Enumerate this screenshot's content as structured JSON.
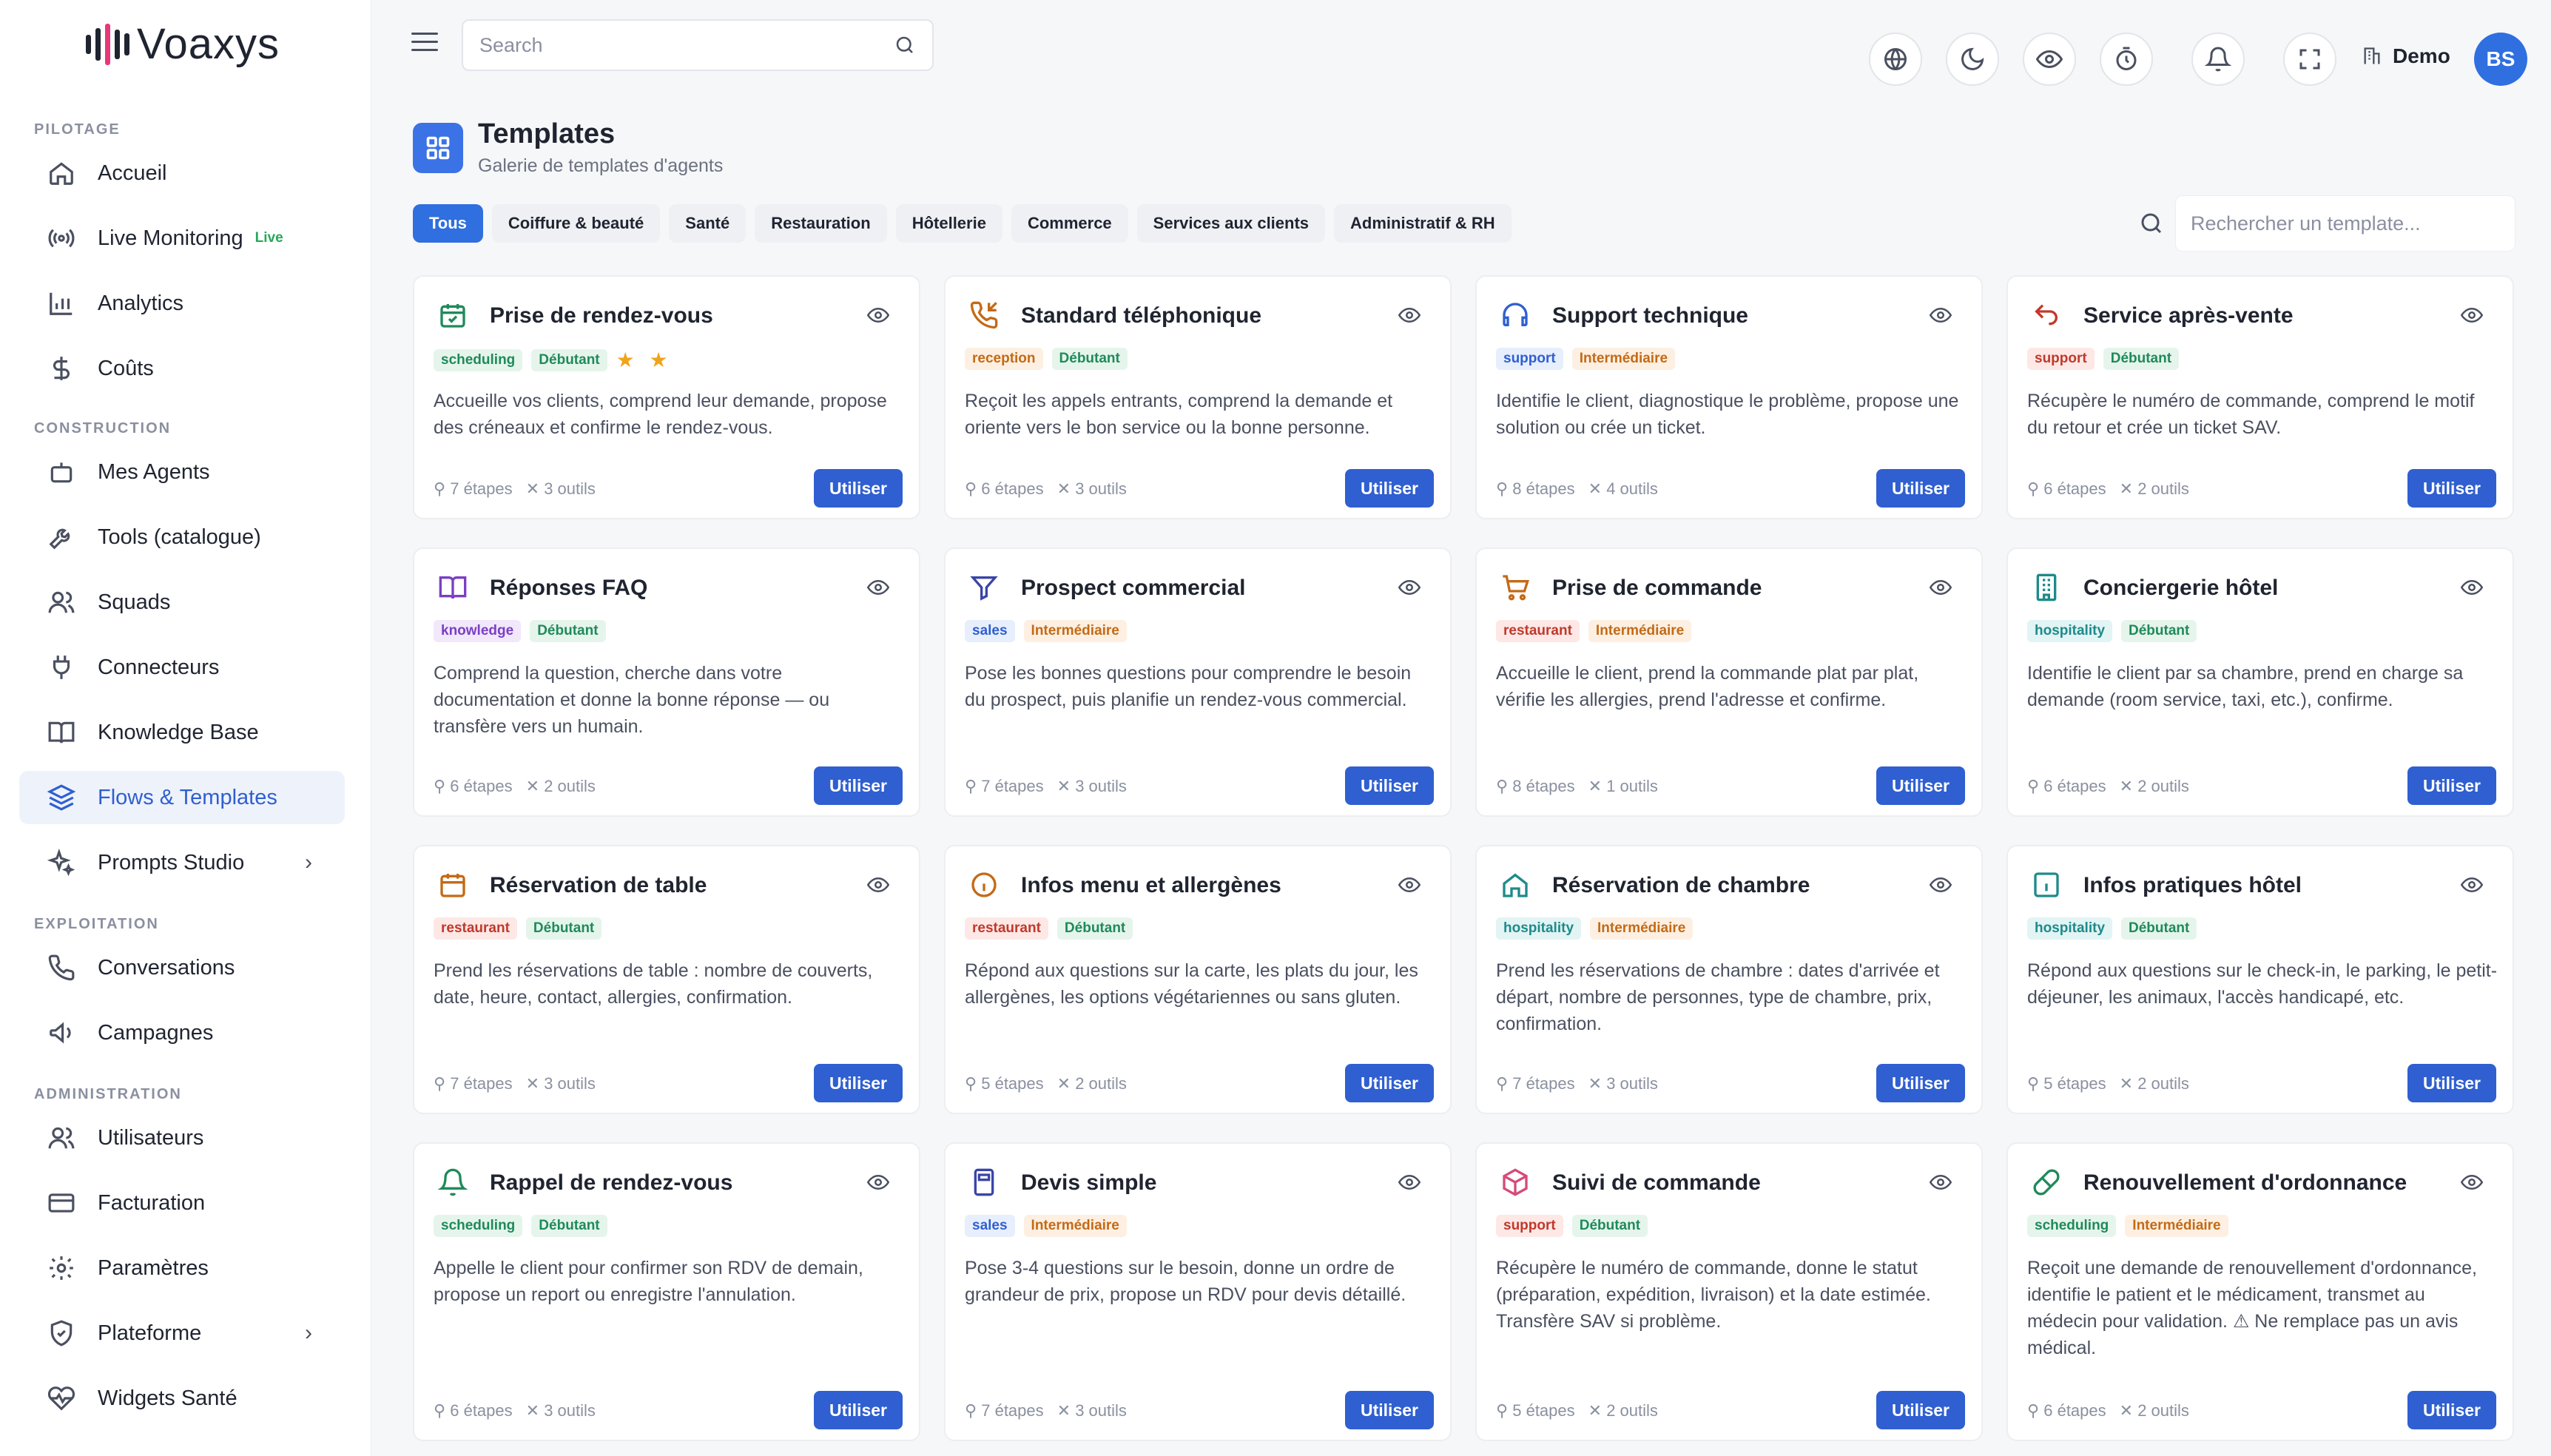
{
  "brand": {
    "name": "Voaxys"
  },
  "sidebar": {
    "sections": [
      "PILOTAGE",
      "CONSTRUCTION",
      "EXPLOITATION",
      "ADMINISTRATION"
    ],
    "items": [
      {
        "label": "Accueil",
        "icon": "home-icon"
      },
      {
        "label": "Live Monitoring",
        "icon": "broadcast-icon",
        "badge": "Live"
      },
      {
        "label": "Analytics",
        "icon": "bar-chart-icon"
      },
      {
        "label": "Coûts",
        "icon": "dollar-icon"
      },
      {
        "label": "Mes Agents",
        "icon": "bot-icon"
      },
      {
        "label": "Tools (catalogue)",
        "icon": "wrench-icon"
      },
      {
        "label": "Squads",
        "icon": "users-icon"
      },
      {
        "label": "Connecteurs",
        "icon": "plug-icon"
      },
      {
        "label": "Knowledge Base",
        "icon": "book-icon"
      },
      {
        "label": "Flows & Templates",
        "icon": "layers-icon",
        "active": true
      },
      {
        "label": "Prompts Studio",
        "icon": "sparkles-icon"
      },
      {
        "label": "Conversations",
        "icon": "phone-icon"
      },
      {
        "label": "Campagnes",
        "icon": "megaphone-icon"
      },
      {
        "label": "Utilisateurs",
        "icon": "users-icon"
      },
      {
        "label": "Facturation",
        "icon": "credit-card-icon"
      },
      {
        "label": "Paramètres",
        "icon": "gear-icon"
      },
      {
        "label": "Plateforme",
        "icon": "shield-icon"
      },
      {
        "label": "Widgets Santé",
        "icon": "heart-pulse-icon"
      }
    ]
  },
  "topbar": {
    "search_placeholder": "Search",
    "workspace": "Demo",
    "avatar_initials": "BS"
  },
  "page": {
    "title": "Templates",
    "subtitle": "Galerie de templates d'agents"
  },
  "filters": {
    "tabs": [
      "Tous",
      "Coiffure & beauté",
      "Santé",
      "Restauration",
      "Hôtellerie",
      "Commerce",
      "Services aux clients",
      "Administratif & RH"
    ],
    "active": "Tous",
    "search_placeholder": "Rechercher un template..."
  },
  "action_label": "Utiliser",
  "colors": {
    "primary": "#2f5fd0",
    "scheduling": "#1f8a5a",
    "reception": "#c46a16",
    "support": "#c0392b",
    "support_tech": "#2f5fd0",
    "knowledge": "#7b3fc4",
    "sales": "#2f5fd0",
    "restaurant": "#c0392b",
    "hospitality": "#1f8a8a",
    "debutant": "#1f8a5a",
    "intermediaire": "#c46a16"
  },
  "templates": [
    {
      "title": "Prise de rendez-vous",
      "icon": "calendar-check-icon",
      "tag": "scheduling",
      "level": "Débutant",
      "stars": "★ ★",
      "desc": "Accueille vos clients, comprend leur demande, propose des créneaux et confirme le rendez-vous.",
      "steps": "7 étapes",
      "tools": "3 outils"
    },
    {
      "title": "Standard téléphonique",
      "icon": "phone-incoming-icon",
      "tag": "reception",
      "level": "Débutant",
      "stars": "",
      "desc": "Reçoit les appels entrants, comprend la demande et oriente vers le bon service ou la bonne personne.",
      "steps": "6 étapes",
      "tools": "3 outils"
    },
    {
      "title": "Support technique",
      "icon": "headset-icon",
      "tag": "support",
      "level": "Intermédiaire",
      "stars": "",
      "desc": "Identifie le client, diagnostique le problème, propose une solution ou crée un ticket.",
      "steps": "8 étapes",
      "tools": "4 outils"
    },
    {
      "title": "Service après-vente",
      "icon": "return-arrow-icon",
      "tag": "support",
      "level": "Débutant",
      "stars": "",
      "desc": "Récupère le numéro de commande, comprend le motif du retour et crée un ticket SAV.",
      "steps": "6 étapes",
      "tools": "2 outils"
    },
    {
      "title": "Réponses FAQ",
      "icon": "book-open-icon",
      "tag": "knowledge",
      "level": "Débutant",
      "stars": "",
      "desc": "Comprend la question, cherche dans votre documentation et donne la bonne réponse — ou transfère vers un humain.",
      "steps": "6 étapes",
      "tools": "2 outils"
    },
    {
      "title": "Prospect commercial",
      "icon": "funnel-icon",
      "tag": "sales",
      "level": "Intermédiaire",
      "stars": "",
      "desc": "Pose les bonnes questions pour comprendre le besoin du prospect, puis planifie un rendez-vous commercial.",
      "steps": "7 étapes",
      "tools": "3 outils"
    },
    {
      "title": "Prise de commande",
      "icon": "cart-icon",
      "tag": "restaurant",
      "level": "Intermédiaire",
      "stars": "",
      "desc": "Accueille le client, prend la commande plat par plat, vérifie les allergies, prend l'adresse et confirme.",
      "steps": "8 étapes",
      "tools": "1 outils"
    },
    {
      "title": "Conciergerie hôtel",
      "icon": "building-icon",
      "tag": "hospitality",
      "level": "Débutant",
      "stars": "",
      "desc": "Identifie le client par sa chambre, prend en charge sa demande (room service, taxi, etc.), confirme.",
      "steps": "6 étapes",
      "tools": "2 outils"
    },
    {
      "title": "Réservation de table",
      "icon": "calendar-icon",
      "tag": "restaurant",
      "level": "Débutant",
      "stars": "",
      "desc": "Prend les réservations de table : nombre de couverts, date, heure, contact, allergies, confirmation.",
      "steps": "7 étapes",
      "tools": "3 outils"
    },
    {
      "title": "Infos menu et allergènes",
      "icon": "info-circle-icon",
      "tag": "restaurant",
      "level": "Débutant",
      "stars": "",
      "desc": "Répond aux questions sur la carte, les plats du jour, les allergènes, les options végétariennes ou sans gluten.",
      "steps": "5 étapes",
      "tools": "2 outils"
    },
    {
      "title": "Réservation de chambre",
      "icon": "house-icon",
      "tag": "hospitality",
      "level": "Intermédiaire",
      "stars": "",
      "desc": "Prend les réservations de chambre : dates d'arrivée et départ, nombre de personnes, type de chambre, prix, confirmation.",
      "steps": "7 étapes",
      "tools": "3 outils"
    },
    {
      "title": "Infos pratiques hôtel",
      "icon": "info-square-icon",
      "tag": "hospitality",
      "level": "Débutant",
      "stars": "",
      "desc": "Répond aux questions sur le check-in, le parking, le petit-déjeuner, les animaux, l'accès handicapé, etc.",
      "steps": "5 étapes",
      "tools": "2 outils"
    },
    {
      "title": "Rappel de rendez-vous",
      "icon": "bell-icon",
      "tag": "scheduling",
      "level": "Débutant",
      "stars": "",
      "desc": "Appelle le client pour confirmer son RDV de demain, propose un report ou enregistre l'annulation.",
      "steps": "6 étapes",
      "tools": "3 outils"
    },
    {
      "title": "Devis simple",
      "icon": "calculator-icon",
      "tag": "sales",
      "level": "Intermédiaire",
      "stars": "",
      "desc": "Pose 3-4 questions sur le besoin, donne un ordre de grandeur de prix, propose un RDV pour devis détaillé.",
      "steps": "7 étapes",
      "tools": "3 outils"
    },
    {
      "title": "Suivi de commande",
      "icon": "package-icon",
      "tag": "support",
      "level": "Débutant",
      "stars": "",
      "desc": "Récupère le numéro de commande, donne le statut (préparation, expédition, livraison) et la date estimée. Transfère SAV si problème.",
      "steps": "5 étapes",
      "tools": "2 outils"
    },
    {
      "title": "Renouvellement d'ordonnance",
      "icon": "pill-icon",
      "tag": "scheduling",
      "level": "Intermédiaire",
      "stars": "",
      "desc": "Reçoit une demande de renouvellement d'ordonnance, identifie le patient et le médicament, transmet au médecin pour validation. ⚠ Ne remplace pas un avis médical.",
      "steps": "6 étapes",
      "tools": "2 outils"
    }
  ]
}
